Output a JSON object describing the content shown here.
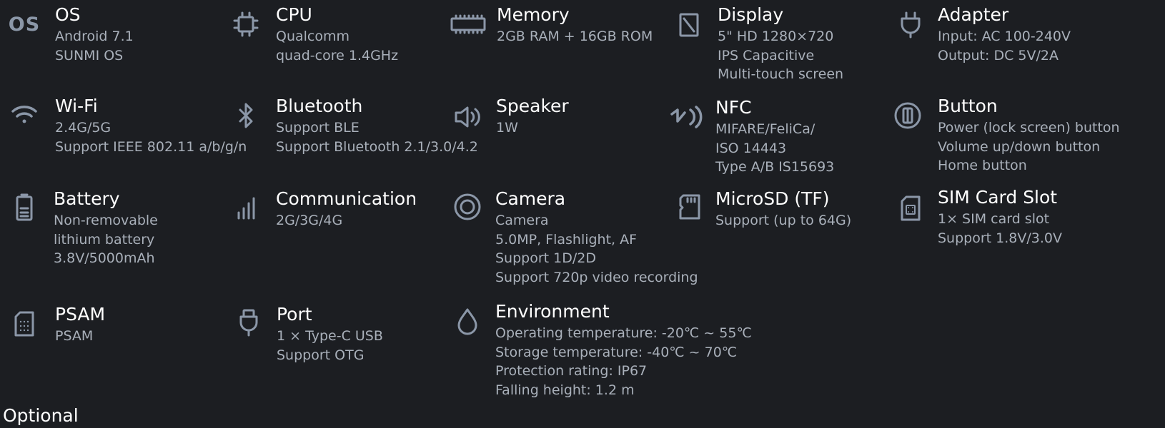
{
  "specs": {
    "os": {
      "title": "OS",
      "lines": [
        "Android 7.1",
        "SUNMI OS"
      ],
      "icon_label": "OS"
    },
    "cpu": {
      "title": "CPU",
      "lines": [
        "Qualcomm",
        "quad-core 1.4GHz"
      ]
    },
    "memory": {
      "title": "Memory",
      "lines": [
        "2GB RAM + 16GB ROM"
      ]
    },
    "display": {
      "title": "Display",
      "lines": [
        "5\" HD 1280×720",
        "IPS Capacitive",
        "Multi-touch screen"
      ]
    },
    "adapter": {
      "title": "Adapter",
      "lines": [
        "Input: AC 100-240V",
        "Output: DC 5V/2A"
      ]
    },
    "wifi": {
      "title": "Wi-Fi",
      "lines": [
        "2.4G/5G",
        "Support IEEE 802.11 a/b/g/n"
      ]
    },
    "bluetooth": {
      "title": "Bluetooth",
      "lines": [
        "Support BLE",
        "Support Bluetooth 2.1/3.0/4.2"
      ]
    },
    "speaker": {
      "title": "Speaker",
      "lines": [
        "1W"
      ]
    },
    "nfc": {
      "title": "NFC",
      "lines": [
        "MIFARE/FeliCa/",
        "ISO 14443",
        "Type A/B IS15693"
      ]
    },
    "button": {
      "title": "Button",
      "lines": [
        "Power (lock screen) button",
        "Volume up/down button",
        "Home button"
      ]
    },
    "battery": {
      "title": "Battery",
      "lines": [
        "Non-removable",
        "lithium battery",
        "3.8V/5000mAh"
      ]
    },
    "communication": {
      "title": "Communication",
      "lines": [
        "2G/3G/4G"
      ]
    },
    "camera": {
      "title": "Camera",
      "lines": [
        "Camera",
        "5.0MP, Flashlight, AF",
        "Support 1D/2D",
        "Support 720p video recording"
      ]
    },
    "microsd": {
      "title": "MicroSD (TF)",
      "lines": [
        "Support (up to 64G)"
      ]
    },
    "sim": {
      "title": "SIM Card Slot",
      "lines": [
        "1× SIM card slot",
        "Support 1.8V/3.0V"
      ]
    },
    "psam": {
      "title": "PSAM",
      "lines": [
        "PSAM"
      ]
    },
    "port": {
      "title": "Port",
      "lines": [
        "1 × Type-C USB",
        "Support OTG"
      ]
    },
    "environment": {
      "title": "Environment",
      "lines": [
        "Operating temperature: -20℃ ~ 55℃",
        "Storage temperature: -40℃ ~ 70℃",
        "Protection rating: IP67",
        "Falling height: 1.2 m"
      ]
    }
  },
  "optional_heading": "Optional"
}
